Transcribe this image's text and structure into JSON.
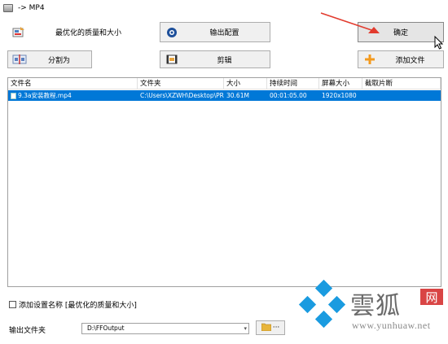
{
  "window": {
    "title": "-> MP4"
  },
  "toolbar": {
    "quality_label": "最优化的质量和大小",
    "output_config_label": "输出配置",
    "ok_label": "确定",
    "split_label": "分割为",
    "edit_label": "剪辑",
    "add_file_label": "添加文件"
  },
  "file_list": {
    "columns": [
      "文件名",
      "文件夹",
      "大小",
      "持续时间",
      "屏幕大小",
      "截取片断"
    ],
    "rows": [
      {
        "name": "9.3a安装教程.mp4",
        "folder": "C:\\Users\\XZWH\\Desktop\\PR...",
        "size": "30.61M",
        "duration": "00:01:05.00",
        "screen": "1920x1080",
        "clip": ""
      }
    ]
  },
  "options": {
    "add_setting_name_label": "添加设置名称 [最优化的质量和大小]",
    "add_setting_name_checked": false
  },
  "output": {
    "folder_label": "输出文件夹",
    "folder_value": "D:\\FFOutput",
    "browse_dots": "···"
  },
  "watermark": {
    "brand": "雲狐",
    "badge": "网",
    "url": "www.yunhuaw.net"
  },
  "colors": {
    "selection": "#0078d7",
    "arrow": "#e23b2e"
  },
  "icons": [
    "app-icon",
    "quality-icon",
    "output-config-icon",
    "split-icon",
    "edit-icon",
    "add-file-icon",
    "folder-icon",
    "cursor-icon"
  ]
}
